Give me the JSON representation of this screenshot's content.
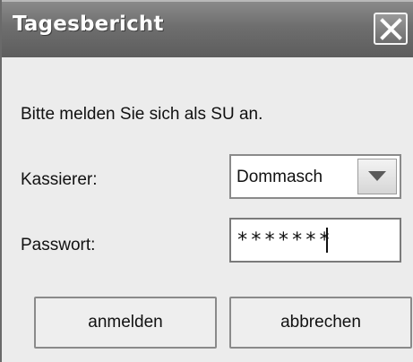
{
  "window": {
    "title": "Tagesbericht",
    "close_icon": "close-icon"
  },
  "message": "Bitte melden Sie sich als SU an.",
  "cashier": {
    "label": "Kassierer:",
    "value": "Dommasch",
    "arrow_icon": "chevron-down-icon"
  },
  "password": {
    "label": "Passwort:",
    "value": "*******"
  },
  "buttons": {
    "login": "anmelden",
    "cancel": "abbrechen"
  },
  "colors": {
    "titlebar": "#6e6e6e",
    "background": "#ececec"
  }
}
